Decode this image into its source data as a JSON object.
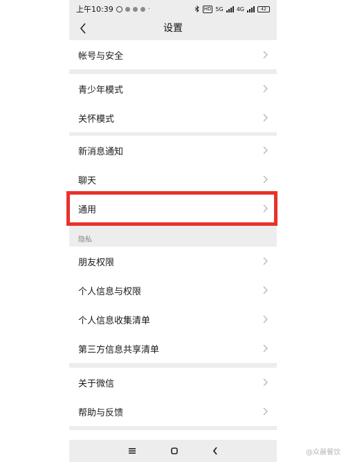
{
  "status_bar": {
    "time": "上午10:39",
    "hd": "HD",
    "network_5g": "5G",
    "network_4g": "4G",
    "battery": "42"
  },
  "header": {
    "title": "设置",
    "back_icon": "chevron-left-icon"
  },
  "groups": [
    {
      "items": [
        "帐号与安全"
      ]
    },
    {
      "items": [
        "青少年模式",
        "关怀模式"
      ]
    },
    {
      "items": [
        "新消息通知",
        "聊天",
        "通用"
      ]
    },
    {
      "section_label": "隐私",
      "items": [
        "朋友权限",
        "个人信息与权限",
        "个人信息收集清单",
        "第三方信息共享清单"
      ]
    },
    {
      "items": [
        "关于微信",
        "帮助与反馈"
      ]
    }
  ],
  "highlighted_item": "通用",
  "highlight_color": "#e8322a",
  "bottom_nav": [
    "menu-icon",
    "home-icon",
    "back-icon"
  ],
  "watermark": "@众晨餐饮"
}
